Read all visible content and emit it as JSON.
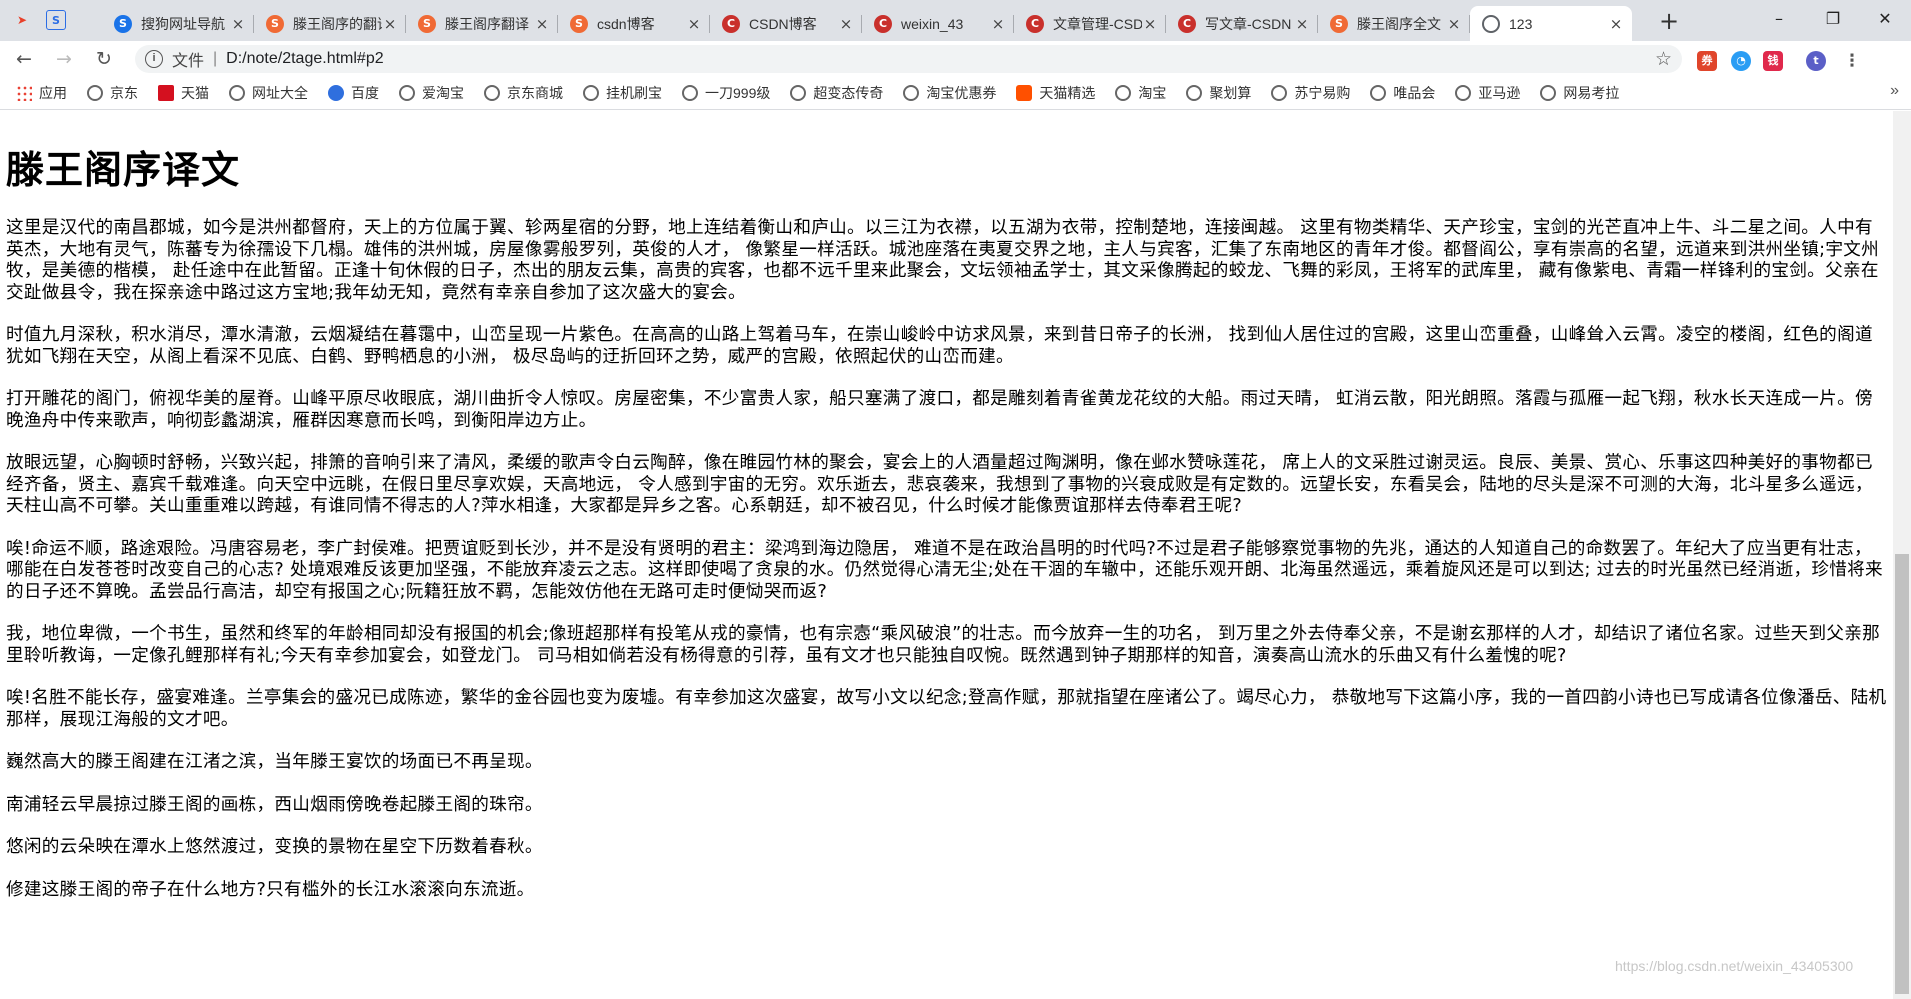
{
  "browser": {
    "tabs": [
      {
        "label": "搜狗网址导航",
        "icon": "sogou-icon",
        "color": "#1a73e8"
      },
      {
        "label": "滕王阁序的翻译",
        "icon": "s-icon",
        "color": "#f06a35"
      },
      {
        "label": "滕王阁序翻译",
        "icon": "s-fire-icon",
        "color": "#f06a35"
      },
      {
        "label": "csdn博客",
        "icon": "s-icon",
        "color": "#f06a35"
      },
      {
        "label": "CSDN博客",
        "icon": "csdn-icon",
        "color": "#c9302c"
      },
      {
        "label": "weixin_43",
        "icon": "csdn-icon",
        "color": "#c9302c"
      },
      {
        "label": "文章管理-CSDN",
        "icon": "csdn-icon",
        "color": "#c9302c"
      },
      {
        "label": "写文章-CSDN",
        "icon": "csdn-icon",
        "color": "#c9302c"
      },
      {
        "label": "滕王阁序全文",
        "icon": "s-icon",
        "color": "#f06a35"
      },
      {
        "label": "123",
        "icon": "globe-icon",
        "color": "#5f6368",
        "active": true
      }
    ],
    "new_tab": "+",
    "window_controls": {
      "minimize": "–",
      "maximize": "❐",
      "close": "✕"
    },
    "omnibox": {
      "scheme_label": "文件",
      "url": "D:/note/2tage.html#p2"
    },
    "profile_initial": "t",
    "bookmarks": [
      {
        "label": "应用",
        "icon": "apps-grid-icon"
      },
      {
        "label": "京东",
        "icon": "globe-icon"
      },
      {
        "label": "天猫",
        "icon": "tmall-icon"
      },
      {
        "label": "网址大全",
        "icon": "globe-icon"
      },
      {
        "label": "百度",
        "icon": "baidu-icon"
      },
      {
        "label": "爱淘宝",
        "icon": "globe-icon"
      },
      {
        "label": "京东商城",
        "icon": "globe-icon"
      },
      {
        "label": "挂机刷宝",
        "icon": "globe-icon"
      },
      {
        "label": "一刀999级",
        "icon": "globe-icon"
      },
      {
        "label": "超变态传奇",
        "icon": "globe-icon"
      },
      {
        "label": "淘宝优惠券",
        "icon": "globe-icon"
      },
      {
        "label": "天猫精选",
        "icon": "taobao-icon"
      },
      {
        "label": "淘宝",
        "icon": "globe-icon"
      },
      {
        "label": "聚划算",
        "icon": "globe-icon"
      },
      {
        "label": "苏宁易购",
        "icon": "globe-icon"
      },
      {
        "label": "唯品会",
        "icon": "globe-icon"
      },
      {
        "label": "亚马逊",
        "icon": "globe-icon"
      },
      {
        "label": "网易考拉",
        "icon": "globe-icon"
      }
    ],
    "bookmarks_more": "»"
  },
  "page": {
    "title": "滕王阁序译文",
    "paragraphs": [
      "这里是汉代的南昌郡城，如今是洪州都督府，天上的方位属于翼、轸两星宿的分野，地上连结着衡山和庐山。以三江为衣襟，以五湖为衣带，控制楚地，连接闽越。 这里有物类精华、天产珍宝，宝剑的光芒直冲上牛、斗二星之间。人中有英杰，大地有灵气，陈蕃专为徐孺设下几榻。雄伟的洪州城，房屋像雾般罗列，英俊的人才， 像繁星一样活跃。城池座落在夷夏交界之地，主人与宾客，汇集了东南地区的青年才俊。都督阎公，享有崇高的名望，远道来到洪州坐镇;宇文州牧，是美德的楷模， 赴任途中在此暂留。正逢十旬休假的日子，杰出的朋友云集，高贵的宾客，也都不远千里来此聚会，文坛领袖孟学士，其文采像腾起的蛟龙、飞舞的彩凤，王将军的武库里， 藏有像紫电、青霜一样锋利的宝剑。父亲在交趾做县令，我在探亲途中路过这方宝地;我年幼无知，竟然有幸亲自参加了这次盛大的宴会。",
      "时值九月深秋，积水消尽，潭水清澈，云烟凝结在暮霭中，山峦呈现一片紫色。在高高的山路上驾着马车，在崇山峻岭中访求风景，来到昔日帝子的长洲， 找到仙人居住过的宫殿，这里山峦重叠，山峰耸入云霄。凌空的楼阁，红色的阁道犹如飞翔在天空，从阁上看深不见底、白鹤、野鸭栖息的小洲， 极尽岛屿的迂折回环之势，威严的宫殿，依照起伏的山峦而建。",
      "打开雕花的阁门，俯视华美的屋脊。山峰平原尽收眼底，湖川曲折令人惊叹。房屋密集，不少富贵人家，船只塞满了渡口，都是雕刻着青雀黄龙花纹的大船。雨过天晴， 虹消云散，阳光朗照。落霞与孤雁一起飞翔，秋水长天连成一片。傍晚渔舟中传来歌声，响彻彭蠡湖滨，雁群因寒意而长鸣，到衡阳岸边方止。",
      "放眼远望，心胸顿时舒畅，兴致兴起，排箫的音响引来了清风，柔缓的歌声令白云陶醉，像在睢园竹林的聚会，宴会上的人酒量超过陶渊明，像在邺水赞咏莲花， 席上人的文采胜过谢灵运。良辰、美景、赏心、乐事这四种美好的事物都已经齐备，贤主、嘉宾千载难逢。向天空中远眺，在假日里尽享欢娱，天高地远， 令人感到宇宙的无穷。欢乐逝去，悲哀袭来，我想到了事物的兴衰成败是有定数的。远望长安，东看吴会，陆地的尽头是深不可测的大海，北斗星多么遥远， 天柱山高不可攀。关山重重难以跨越，有谁同情不得志的人?萍水相逢，大家都是异乡之客。心系朝廷，却不被召见，什么时候才能像贾谊那样去侍奉君王呢?",
      "唉!命运不顺，路途艰险。冯唐容易老，李广封侯难。把贾谊贬到长沙，并不是没有贤明的君主：梁鸿到海边隐居， 难道不是在政治昌明的时代吗?不过是君子能够察觉事物的先兆，通达的人知道自己的命数罢了。年纪大了应当更有壮志，哪能在白发苍苍时改变自己的心志? 处境艰难反该更加坚强，不能放弃凌云之志。这样即使喝了贪泉的水。仍然觉得心清无尘;处在干涸的车辙中，还能乐观开朗、北海虽然遥远，乘着旋风还是可以到达; 过去的时光虽然已经消逝，珍惜将来的日子还不算晚。孟尝品行高洁，却空有报国之心;阮籍狂放不羁，怎能效仿他在无路可走时便恸哭而返?",
      "我，地位卑微，一个书生，虽然和终军的年龄相同却没有报国的机会;像班超那样有投笔从戎的豪情，也有宗悫“乘风破浪”的壮志。而今放弃一生的功名， 到万里之外去侍奉父亲，不是谢玄那样的人才，却结识了诸位名家。过些天到父亲那里聆听教诲，一定像孔鲤那样有礼;今天有幸参加宴会，如登龙门。 司马相如倘若没有杨得意的引荐，虽有文才也只能独自叹惋。既然遇到钟子期那样的知音，演奏高山流水的乐曲又有什么羞愧的呢?",
      "唉!名胜不能长存，盛宴难逢。兰亭集会的盛况已成陈迹，繁华的金谷园也变为废墟。有幸参加这次盛宴，故写小文以纪念;登高作赋，那就指望在座诸公了。竭尽心力， 恭敬地写下这篇小序，我的一首四韵小诗也已写成请各位像潘岳、陆机那样，展现江海般的文才吧。",
      "巍然高大的滕王阁建在江渚之滨，当年滕王宴饮的场面已不再呈现。",
      "南浦轻云早晨掠过滕王阁的画栋，西山烟雨傍晚卷起滕王阁的珠帘。",
      "悠闲的云朵映在潭水上悠然渡过，变换的景物在星空下历数着春秋。",
      "修建这滕王阁的帝子在什么地方?只有槛外的长江水滚滚向东流逝。"
    ]
  },
  "watermark": "https://blog.csdn.net/weixin_43405300"
}
